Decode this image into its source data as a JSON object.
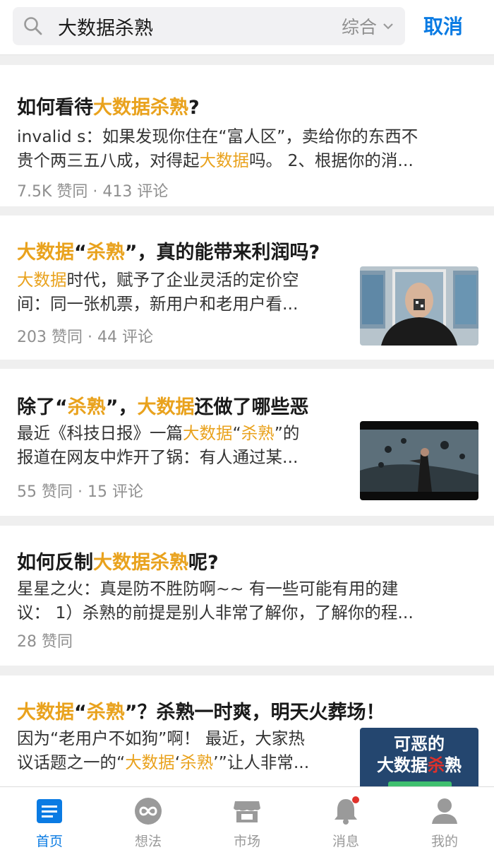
{
  "search": {
    "query": "大数据杀熟",
    "sort_label": "综合",
    "cancel_label": "取消"
  },
  "results": [
    {
      "title": [
        {
          "t": "如何看待"
        },
        {
          "t": "大数据杀熟",
          "h": 1
        },
        {
          "t": "?"
        }
      ],
      "lines": [
        [
          {
            "t": "invalid s：如果发现你住在“富人区”，卖给你的东西不"
          }
        ],
        [
          {
            "t": "贵个两三五八成，对得起"
          },
          {
            "t": "大数据",
            "h": 1
          },
          {
            "t": "吗。 2、根据你的消..."
          }
        ]
      ],
      "meta": "7.5K 赞同 · 413 评论"
    },
    {
      "title": [
        {
          "t": "大数据",
          "h": 1
        },
        {
          "t": "“"
        },
        {
          "t": "杀熟",
          "h": 1
        },
        {
          "t": "”，真的能带来利润吗?"
        }
      ],
      "lines": [
        [
          {
            "t": "大数据",
            "h": 1
          },
          {
            "t": "时代，赋予了企业灵活的定价空"
          }
        ],
        [
          {
            "t": "间：同一张机票，新用户和老用户看..."
          }
        ]
      ],
      "meta": "203 赞同 · 44 评论"
    },
    {
      "title": [
        {
          "t": "除了“"
        },
        {
          "t": "杀熟",
          "h": 1
        },
        {
          "t": "”，"
        },
        {
          "t": "大数据",
          "h": 1
        },
        {
          "t": "还做了哪些恶"
        }
      ],
      "lines": [
        [
          {
            "t": "最近《科技日报》一篇"
          },
          {
            "t": "大数据",
            "h": 1
          },
          {
            "t": "“"
          },
          {
            "t": "杀熟",
            "h": 1
          },
          {
            "t": "”的"
          }
        ],
        [
          {
            "t": "报道在网友中炸开了锅：有人通过某..."
          }
        ]
      ],
      "meta": "55 赞同 · 15 评论"
    },
    {
      "title": [
        {
          "t": "如何反制"
        },
        {
          "t": "大数据杀熟",
          "h": 1
        },
        {
          "t": "呢?"
        }
      ],
      "lines": [
        [
          {
            "t": "星星之火：真是防不胜防啊~~ 有一些可能有用的建"
          }
        ],
        [
          {
            "t": "议： 1）杀熟的前提是别人非常了解你，了解你的程..."
          }
        ]
      ],
      "meta": "28 赞同"
    },
    {
      "title": [
        {
          "t": "大数据",
          "h": 1
        },
        {
          "t": "“"
        },
        {
          "t": "杀熟",
          "h": 1
        },
        {
          "t": "”？杀熟一时爽，明天火葬场！"
        }
      ],
      "lines": [
        [
          {
            "t": "因为“老用户不如狗”啊！ 最近，大家热"
          }
        ],
        [
          {
            "t": "议话题之一的“"
          },
          {
            "t": "大数据",
            "h": 1
          },
          {
            "t": "‘"
          },
          {
            "t": "杀熟",
            "h": 1
          },
          {
            "t": "’”让人非常..."
          }
        ]
      ],
      "meta": "",
      "thumb_text": {
        "line1": "可恶的",
        "line2_a": "大数据",
        "line2_b": "杀",
        "line2_c": "熟"
      }
    }
  ],
  "tabs": [
    {
      "label": "首页",
      "icon": "home-feed-icon"
    },
    {
      "label": "想法",
      "icon": "ideas-icon"
    },
    {
      "label": "市场",
      "icon": "market-icon"
    },
    {
      "label": "消息",
      "icon": "notification-bell-icon"
    },
    {
      "label": "我的",
      "icon": "profile-icon"
    }
  ],
  "colors": {
    "accent": "#0a7be3",
    "highlight": "#e9a21d",
    "notification_dot": "#e0312b"
  }
}
